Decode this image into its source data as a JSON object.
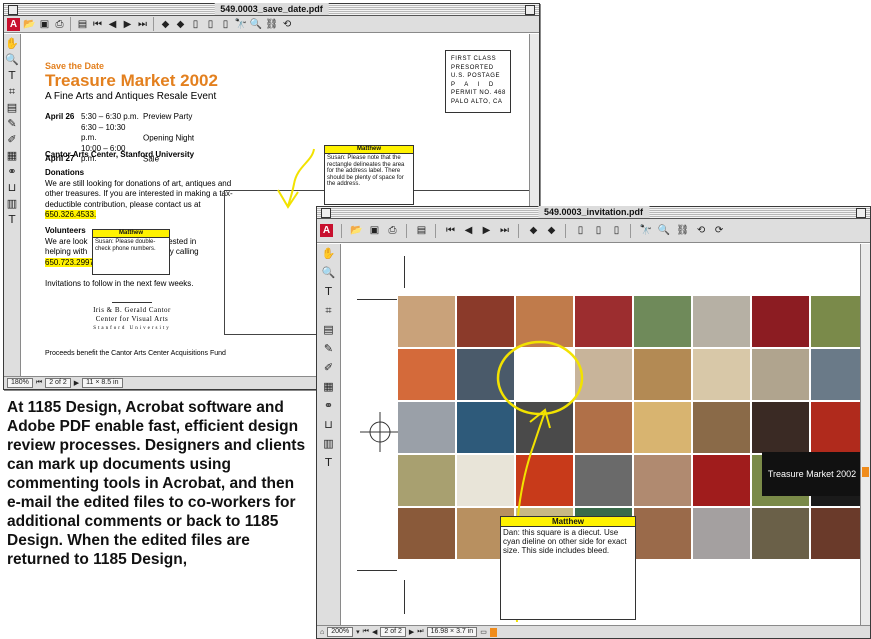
{
  "win1": {
    "title": "549.0003_save_date.pdf",
    "toolbar_icons": [
      "adobe-logo",
      "open-icon",
      "save-icon",
      "print-icon",
      "thumbnails-icon",
      "first-page-icon",
      "prev-page-icon",
      "next-page-icon",
      "last-page-icon",
      "back-icon",
      "forward-icon",
      "actual-size-icon",
      "fit-page-icon",
      "fit-width-icon",
      "find-icon",
      "search-icon",
      "links-icon",
      "rotate-left-icon",
      "rotate-right-icon"
    ],
    "status": {
      "zoom": "180%",
      "page": "2 of 2",
      "size": "11 × 8.5 in"
    },
    "doc": {
      "save_the_date": "Save the Date",
      "title": "Treasure Market 2002",
      "subtitle": "A Fine Arts and Antiques Resale Event",
      "schedule": [
        {
          "date": "April 26",
          "time": "5:30 – 6:30 p.m.",
          "event": "Preview Party"
        },
        {
          "date": "",
          "time": "6:30 – 10:30 p.m.",
          "event": "Opening Night"
        },
        {
          "date": "April 27",
          "time": "10:00 – 6:00 p.m.",
          "event": "Sale"
        }
      ],
      "venue": "Cantor Arts Center, Stanford University",
      "donations_heading": "Donations",
      "donations_text": "We are still looking for donations of art, antiques and other treasures. If you are interested in making a tax-deductible contribution, please contact us at",
      "donations_phone": "650.326.4533.",
      "volunteers_heading": "Volunteers",
      "volunteers_text_a": "We are look",
      "volunteers_text_b": "rested in",
      "volunteers_text_c": "helping with",
      "volunteers_text_d": "by calling",
      "volunteers_phone": "650.723.2997",
      "invitations": "Invitations to follow in the next few weeks.",
      "logo_line1": "Iris & B. Gerald Cantor",
      "logo_line2": "Center for Visual Arts",
      "logo_line3": "Stanford University",
      "proceeds": "Proceeds benefit the Cantor Arts Center Acquisitions Fund",
      "postage": [
        "FIRST CLASS",
        "PRESORTED",
        "U.S. POSTAGE",
        "P  A  I  D",
        "PERMIT NO. 468",
        "PALO ALTO, CA"
      ]
    },
    "note_address": {
      "author": "Matthew",
      "text": "Susan: Please note that the rectangle delineates the area for the address label. There should be plenty of space for the address."
    },
    "note_phone": {
      "author": "Matthew",
      "text": "Susan: Please double-check phone numbers."
    }
  },
  "win2": {
    "title": "549.0003_invitation.pdf",
    "status": {
      "zoom": "200%",
      "page": "2 of 2",
      "size": "16.98 × 3.7 in"
    },
    "banner": "Treasure Market 2002",
    "note": {
      "author": "Matthew",
      "text": "Dan: this square is a diecut. Use cyan dieline on other side for exact size. This side includes bleed."
    },
    "tile_colors": [
      "#c9a27a",
      "#8b3a2a",
      "#c07b4b",
      "#9c2d2f",
      "#6f8a5a",
      "#b6b0a4",
      "#8c1c22",
      "#7a8a4a",
      "#d46a3a",
      "#4a5a6a",
      "#ffffff",
      "#c8b49a",
      "#b38a54",
      "#d8c8a8",
      "#b0a48e",
      "#6a7a88",
      "#9aa0a8",
      "#2e5a7a",
      "#4a4a4a",
      "#b07048",
      "#d8b470",
      "#8a6a48",
      "#3a2a24",
      "#b02a1c",
      "#a8a070",
      "#e8e4d8",
      "#c83a1a",
      "#6a6a6a",
      "#b08a70",
      "#a01c1c",
      "#7a8a48",
      "#1a1a1a",
      "#8a5a3a",
      "#b89060",
      "#c8b884",
      "#3a6a4a",
      "#9a6a4a",
      "#a4a0a0",
      "#6a6048",
      "#6a3a2a"
    ]
  },
  "caption": "At 1185 Design, Acrobat software and Adobe PDF enable fast, efficient design review processes. Designers and clients can mark up documents using commenting tools in Acrobat, and then e-mail the edited files to co-workers for additional comments or back to 1185 Design. When the edited files are returned to 1185 Design,"
}
